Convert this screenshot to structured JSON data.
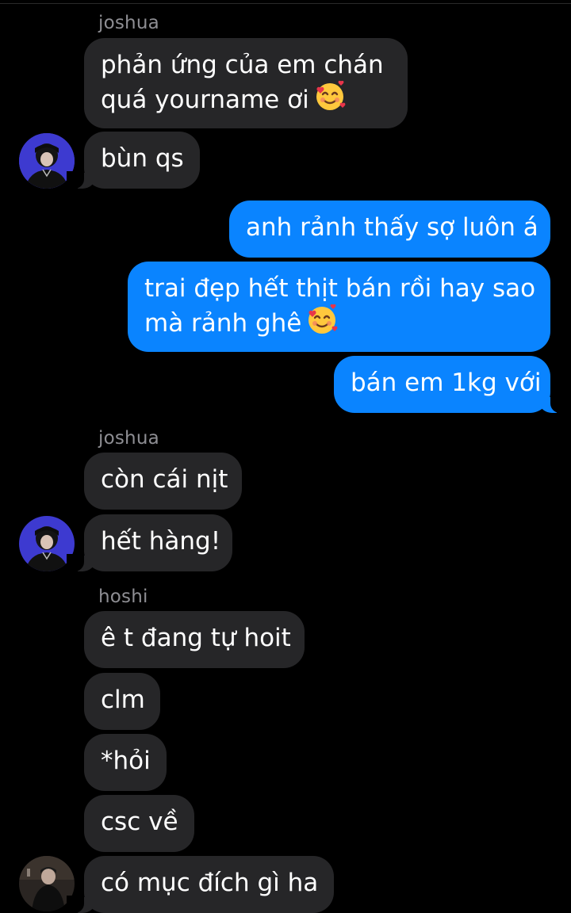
{
  "conversation": {
    "groups": [
      {
        "sender": "joshua",
        "messages": [
          {
            "line1": "phản ứng của em chán",
            "line2": "quá yourname ơi",
            "emoji": "smiling-face-with-hearts-emoji"
          },
          {
            "text": "bùn qs"
          }
        ],
        "avatar": "joshua-avatar"
      },
      {
        "sender": "me",
        "messages": [
          {
            "text": "anh rảnh thấy sợ luôn á"
          },
          {
            "line1": "trai đẹp hết thịt bán rồi hay sao",
            "line2": "mà rảnh ghê",
            "emoji": "smiling-face-with-hearts-emoji"
          },
          {
            "text": "bán em 1kg với"
          }
        ]
      },
      {
        "sender": "joshua",
        "messages": [
          {
            "text": "còn cái nịt"
          },
          {
            "text": "hết hàng!"
          }
        ],
        "avatar": "joshua-avatar"
      },
      {
        "sender": "hoshi",
        "messages": [
          {
            "text": "ê t đang tự hoit"
          },
          {
            "text": "clm"
          },
          {
            "text": "*hỏi"
          },
          {
            "text": "csc về"
          },
          {
            "text": "có mục đích gì ha"
          }
        ],
        "avatar": "hoshi-avatar"
      }
    ]
  },
  "colors": {
    "background": "#000000",
    "incoming_bubble": "#262628",
    "outgoing_bubble": "#0a84ff",
    "sender_name": "#8e8e93",
    "text": "#ffffff"
  }
}
